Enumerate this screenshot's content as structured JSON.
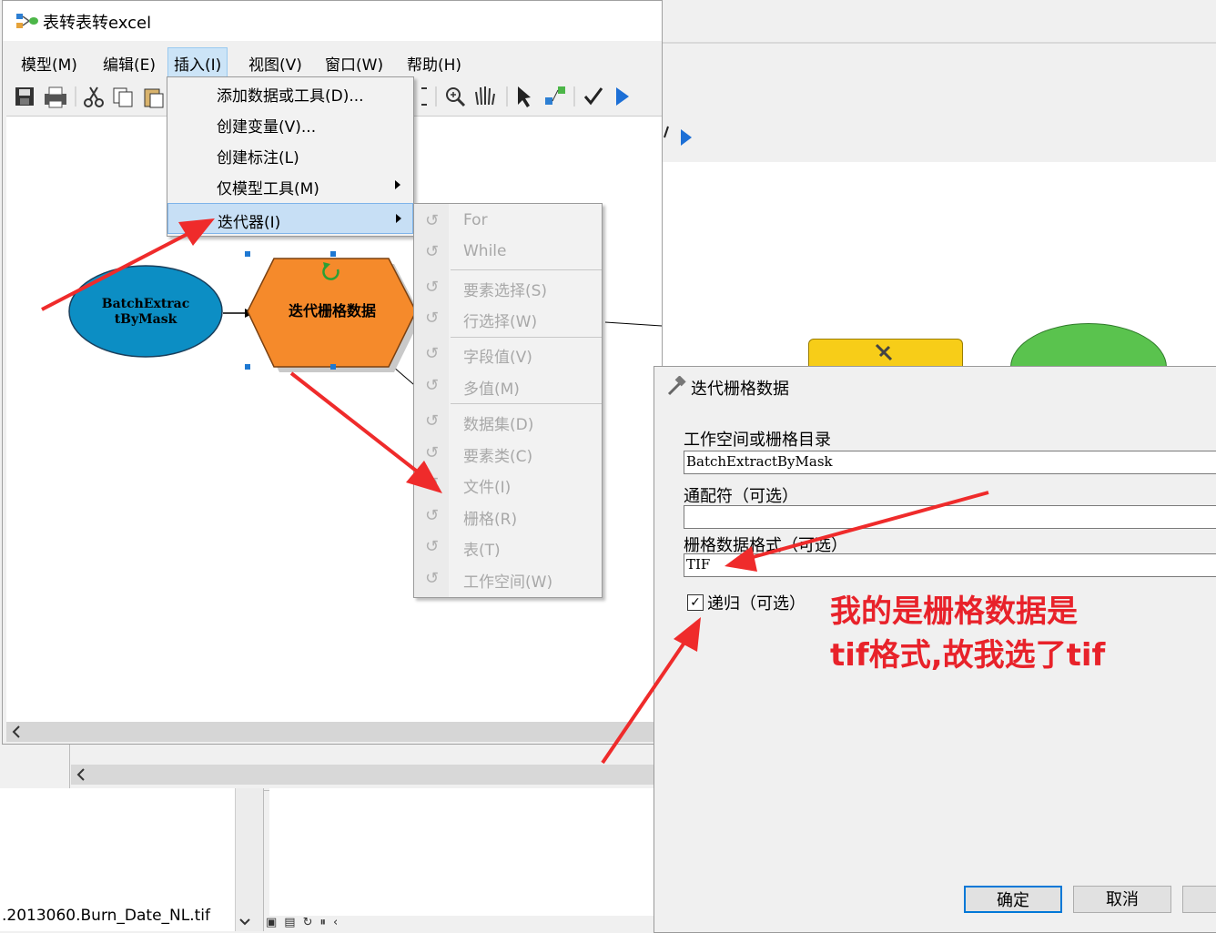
{
  "window": {
    "title": "表转表转excel"
  },
  "menubar": [
    {
      "label": "模型(M)"
    },
    {
      "label": "编辑(E)"
    },
    {
      "label": "插入(I)"
    },
    {
      "label": "视图(V)"
    },
    {
      "label": "窗口(W)"
    },
    {
      "label": "帮助(H)"
    }
  ],
  "insert_menu": [
    {
      "label": "添加数据或工具(D)..."
    },
    {
      "label": "创建变量(V)..."
    },
    {
      "label": "创建标注(L)"
    },
    {
      "label": "仅模型工具(M)"
    },
    {
      "label": "迭代器(I)"
    }
  ],
  "iterator_menu": [
    {
      "label": "For"
    },
    {
      "label": "While"
    },
    {
      "label": "要素选择(S)"
    },
    {
      "label": "行选择(W)"
    },
    {
      "label": "字段值(V)"
    },
    {
      "label": "多值(M)"
    },
    {
      "label": "数据集(D)"
    },
    {
      "label": "要素类(C)"
    },
    {
      "label": "文件(I)"
    },
    {
      "label": "栅格(R)"
    },
    {
      "label": "表(T)"
    },
    {
      "label": "工作空间(W)"
    }
  ],
  "model": {
    "input_node_line1": "BatchExtrac",
    "input_node_line2": "tByMask",
    "iterator_node": "迭代栅格数据",
    "input_color": "#0c8ec4",
    "iterator_color": "#f58a2b"
  },
  "dialog": {
    "title": "迭代栅格数据",
    "workspace_label": "工作空间或栅格目录",
    "workspace_value": "BatchExtractByMask",
    "wildcard_label": "通配符（可选）",
    "wildcard_value": "",
    "format_label": "栅格数据格式（可选）",
    "format_value": "TIF",
    "recursive_label": "递归（可选）",
    "recursive_checked": true,
    "ok_label": "确定",
    "cancel_label": "取消"
  },
  "annotation": {
    "line1": "我的是栅格数据是",
    "line2": "tif格式,故我选了tif",
    "color": "#e8222a"
  },
  "status_bar": {
    "file_name": ".2013060.Burn_Date_NL.tif"
  }
}
